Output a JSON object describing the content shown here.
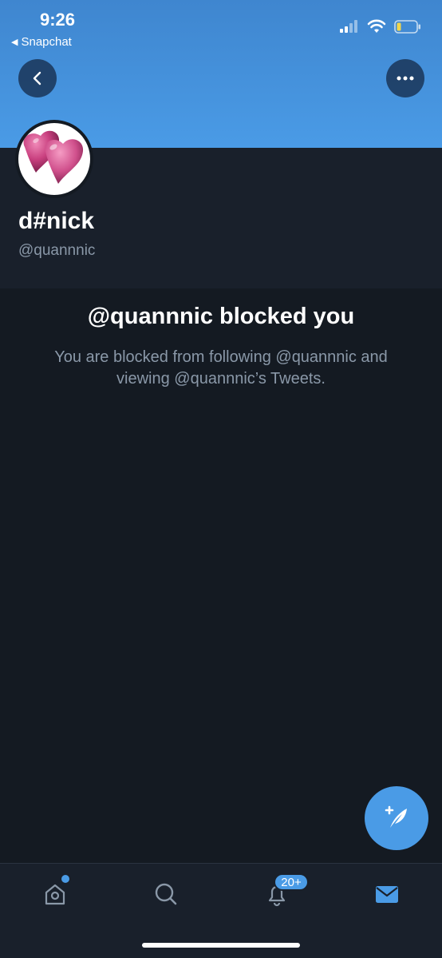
{
  "status_bar": {
    "time": "9:26",
    "back_app": "Snapchat",
    "back_app_arrow": "◀"
  },
  "profile": {
    "display_name": "d#nick",
    "handle": "@quannnic",
    "avatar": "pink-hearts-image"
  },
  "blocked": {
    "title": "@quannnic blocked you",
    "message": "You are blocked from following @quannnic and viewing @quannnic’s Tweets."
  },
  "tab_bar": {
    "notifications_badge": "20+"
  },
  "colors": {
    "accent": "#4a9be6",
    "background": "#141a22",
    "profile_background": "#19202b",
    "secondary_text": "#8a98a8"
  },
  "icons": [
    "back-icon",
    "more-icon",
    "compose-icon",
    "home-icon",
    "search-icon",
    "bell-icon",
    "mail-icon"
  ]
}
